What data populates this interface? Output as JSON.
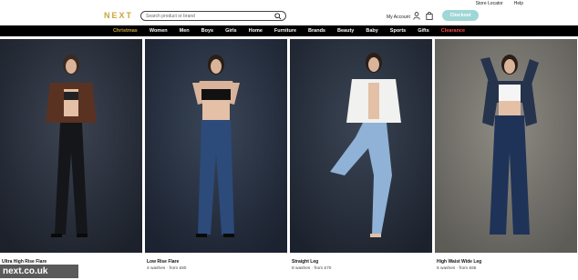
{
  "utility": {
    "store_locator": "Store Locator",
    "help": "Help"
  },
  "header": {
    "logo": "NEXT",
    "search_placeholder": "Search product or brand",
    "account": "My Account",
    "checkout": "Checkout"
  },
  "nav": [
    "Christmas",
    "Women",
    "Men",
    "Boys",
    "Girls",
    "Home",
    "Furniture",
    "Brands",
    "Beauty",
    "Baby",
    "Sports",
    "Gifts",
    "Clearance"
  ],
  "colors": {
    "brand_gold": "#c9a63b",
    "checkout": "#9fd6d6",
    "clearance": "#ff4a4a",
    "nav_bg": "#000000"
  },
  "products": [
    {
      "name": "Ultra High Rise Flare",
      "meta": "4 washes · from £..."
    },
    {
      "name": "Low Rise Flare",
      "meta": "4 washes · from £80"
    },
    {
      "name": "Straight Leg",
      "meta": "8 washes · from £70"
    },
    {
      "name": "High Waist Wide Leg",
      "meta": "6 washes · from £65"
    }
  ],
  "watermark": "next.co.uk"
}
